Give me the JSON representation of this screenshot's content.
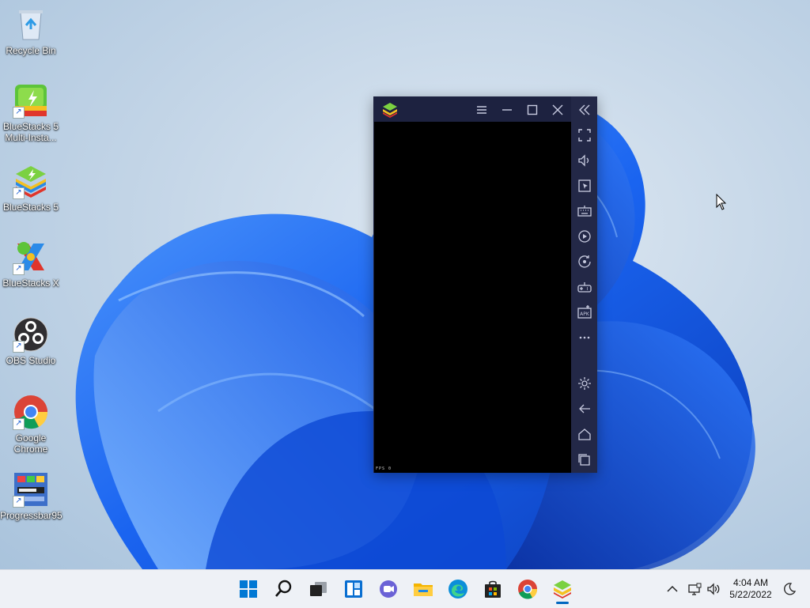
{
  "desktop": {
    "icons": [
      {
        "label": "Recycle Bin",
        "icon": "recycle-bin-icon"
      },
      {
        "label": "BlueStacks 5 Multi-Insta...",
        "icon": "bluestacks-multi-instance-icon"
      },
      {
        "label": "BlueStacks 5",
        "icon": "bluestacks-5-icon"
      },
      {
        "label": "BlueStacks X",
        "icon": "bluestacks-x-icon"
      },
      {
        "label": "OBS Studio",
        "icon": "obs-studio-icon"
      },
      {
        "label": "Google Chrome",
        "icon": "google-chrome-icon"
      },
      {
        "label": "Progressbar95",
        "icon": "progressbar95-icon"
      }
    ]
  },
  "bluestacks": {
    "fps_text": "FPS  0",
    "titlebar": [
      "menu-icon",
      "minimize-icon",
      "maximize-icon",
      "close-icon",
      "collapse-sidebar-icon"
    ],
    "sidebar": [
      "fullscreen-icon",
      "volume-icon",
      "pointer-icon",
      "keyboard-icon",
      "macro-icon",
      "rotate-icon",
      "gamepad-icon",
      "install-apk-icon",
      "more-icon",
      "settings-icon",
      "back-icon",
      "home-icon",
      "recent-apps-icon"
    ]
  },
  "taskbar": {
    "apps": [
      "start-icon",
      "search-icon",
      "task-view-icon",
      "widgets-icon",
      "chat-icon",
      "file-explorer-icon",
      "edge-icon",
      "store-icon",
      "chrome-icon",
      "bluestacks-icon"
    ],
    "tray": [
      "show-hidden-icons-chevron",
      "network-icon",
      "volume-icon",
      "focus-assist-icon"
    ],
    "time": "4:04 AM",
    "date": "5/22/2022"
  },
  "colors": {
    "accent": "#0067c0",
    "bluestacks_frame": "#1d2240",
    "bluestacks_sidebar": "#232847"
  }
}
